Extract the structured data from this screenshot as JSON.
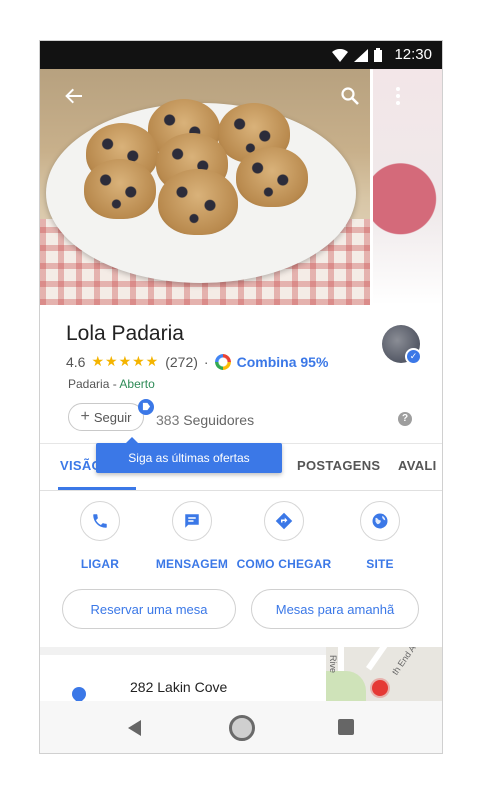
{
  "status_bar": {
    "time": "12:30"
  },
  "icons": {
    "back": "arrow-left-icon",
    "search": "search-icon",
    "more": "more-vert-icon",
    "phone": "phone-icon",
    "message": "chat-icon",
    "directions": "directions-icon",
    "site": "globe-icon"
  },
  "place": {
    "name": "Lola Padaria",
    "rating": "4.6",
    "stars": "★★★★★",
    "reviews": "(272)",
    "separator": "·",
    "match": "Combina 95%",
    "category": "Padaria",
    "category_sep": " - ",
    "status": "Aberto"
  },
  "follow": {
    "button_plus": "+",
    "button_label": "Seguir",
    "followers_count": "383",
    "followers_label": "Seguidores",
    "help": "?",
    "tooltip": "Siga as últimas ofertas"
  },
  "tabs": [
    {
      "label": "VISÃO",
      "active": true
    },
    {
      "label": "POSTAGENS",
      "active": false
    },
    {
      "label": "AVALI",
      "active": false
    }
  ],
  "actions": [
    {
      "label": "LIGAR"
    },
    {
      "label": "MENSAGEM"
    },
    {
      "label": "COMO CHEGAR"
    },
    {
      "label": "SITE"
    }
  ],
  "chips": [
    {
      "label": "Reservar uma mesa"
    },
    {
      "label": "Mesas para amanhã"
    }
  ],
  "address": {
    "line1": "282 Lakin Cove"
  },
  "map": {
    "label_left": "Rive",
    "label_right": "th End A"
  },
  "colors": {
    "accent": "#3b78e7",
    "open": "#2e8b57",
    "star": "#f4b400"
  }
}
